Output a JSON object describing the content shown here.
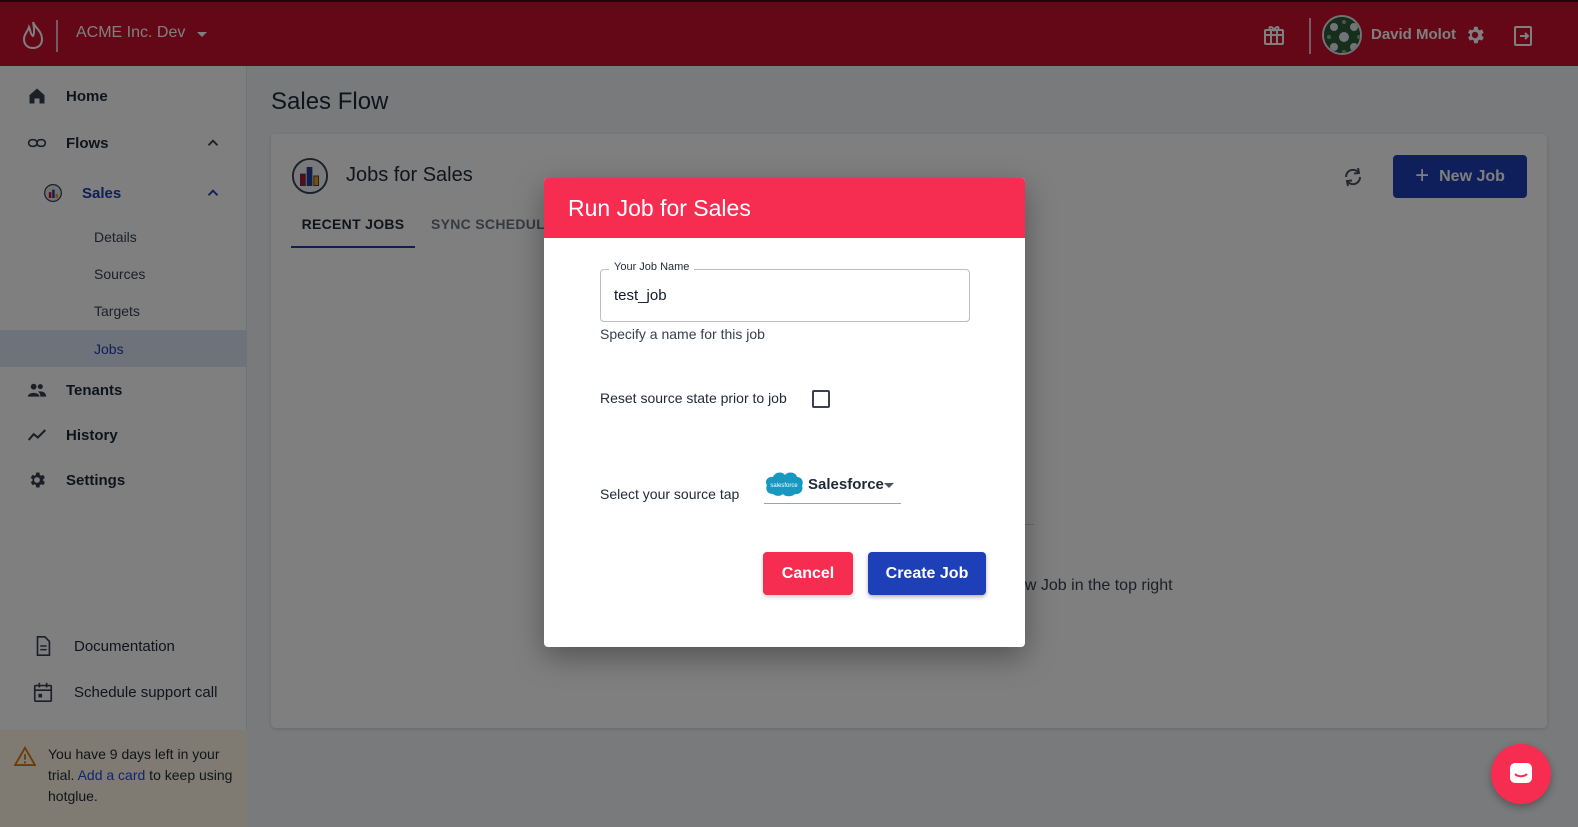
{
  "topbar": {
    "org_name": "ACME Inc. Dev",
    "user_name": "David Molot"
  },
  "sidebar": {
    "home": "Home",
    "flows": "Flows",
    "sales": "Sales",
    "details": "Details",
    "sources": "Sources",
    "targets": "Targets",
    "jobs": "Jobs",
    "tenants": "Tenants",
    "history": "History",
    "settings": "Settings",
    "documentation": "Documentation",
    "support": "Schedule support call",
    "trial": {
      "prefix": "You have 9 days left in your trial. ",
      "link": "Add a card",
      "suffix": " to keep using hotglue."
    }
  },
  "main": {
    "page_title": "Sales Flow",
    "card_title": "Jobs for Sales",
    "new_job": "New Job",
    "tabs": [
      "RECENT JOBS",
      "SYNC SCHEDULE"
    ],
    "empty_hint": "ew Job in the top right"
  },
  "modal": {
    "title": "Run Job for Sales",
    "job_name_label": "Your Job Name",
    "job_name_value": "test_job",
    "job_name_helper": "Specify a name for this job",
    "reset_label": "Reset source state prior to job",
    "reset_checked": false,
    "tap_label": "Select your source tap",
    "tap_value": "Salesforce",
    "tap_logo_text": "salesforce",
    "cancel": "Cancel",
    "create": "Create Job"
  },
  "colors": {
    "topbar": "#c8102e",
    "accent_red": "#f62d51",
    "primary_blue": "#1d3fb8"
  }
}
